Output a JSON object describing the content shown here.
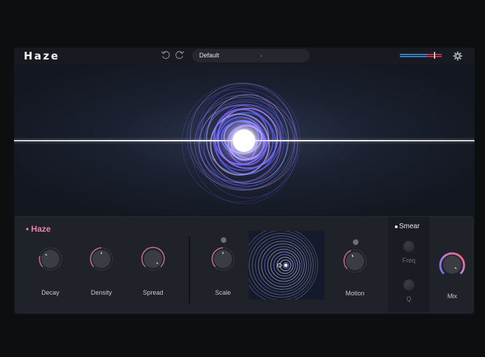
{
  "app": {
    "title": "Haze"
  },
  "toolbar": {
    "preset": "Default",
    "undo_icon": "undo-icon",
    "redo_icon": "redo-icon",
    "settings_icon": "gear-icon",
    "io_meter_icon": "io-meter-icon"
  },
  "module": {
    "title": "Haze",
    "accent": "#e985a9"
  },
  "knobs": [
    {
      "label": "Decay"
    },
    {
      "label": "Density"
    },
    {
      "label": "Spread"
    },
    {
      "label": "Scale"
    },
    {
      "label": "Motion"
    }
  ],
  "smear": {
    "title": "Smear",
    "freq_label": "Freq",
    "q_label": "Q"
  },
  "mix": {
    "label": "Mix"
  },
  "colors": {
    "accent_pink": "#e985a9",
    "accent_blue": "#3a9cf0",
    "accent_red": "#e0405a",
    "background": "#0d0e10"
  }
}
